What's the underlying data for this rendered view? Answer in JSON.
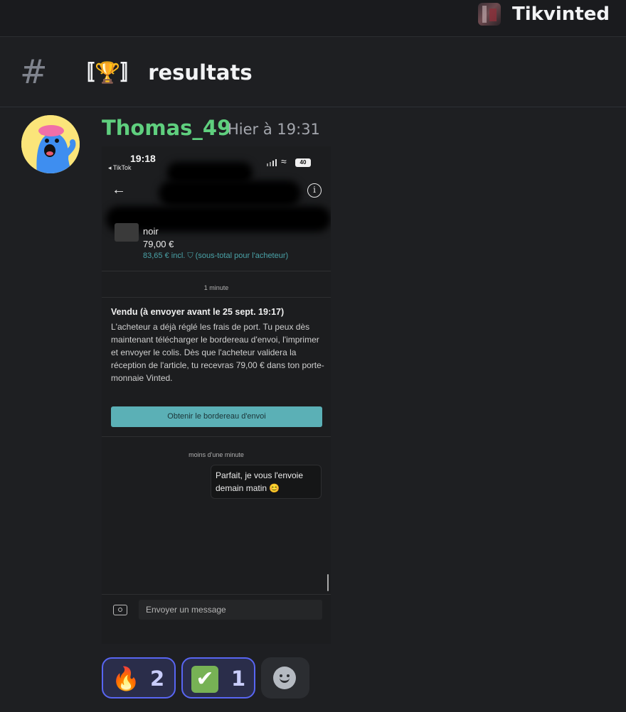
{
  "server": {
    "name": "Tikvinted",
    "icon": "server-avatar-icon"
  },
  "channel": {
    "hash_icon": "#",
    "name": "〚🏆〛 resultats"
  },
  "message": {
    "author": "Thomas_49",
    "author_color": "#5fcf7e",
    "timestamp": "Hier à 19:31",
    "attachment": {
      "status_time": "19:18",
      "status_back": "◂ TikTok",
      "battery": "40",
      "item_title": "noir",
      "item_price": "79,00 €",
      "item_incl": "83,65 € incl. ⛉ (sous-total pour l'acheteur)",
      "system_time_1": "1 minute",
      "vendu_title": "Vendu (à envoyer avant le 25 sept. 19:17)",
      "vendu_body": "L'acheteur a déjà réglé les frais de port. Tu peux dès maintenant télécharger le bordereau d'envoi, l'imprimer et envoyer le colis. Dès que l'acheteur validera la réception de l'article, tu recevras 79,00 € dans ton porte-monnaie Vinted.",
      "cta_label": "Obtenir le bordereau d'envoi",
      "system_time_2": "moins d'une minute",
      "bubble_text": "Parfait, je vous l'envoie demain matin 😊",
      "input_placeholder": "Envoyer un message"
    }
  },
  "reactions": [
    {
      "emoji": "🔥",
      "count": "2"
    },
    {
      "emoji": "✔",
      "count": "1"
    }
  ],
  "accent_color": "#5865f2"
}
